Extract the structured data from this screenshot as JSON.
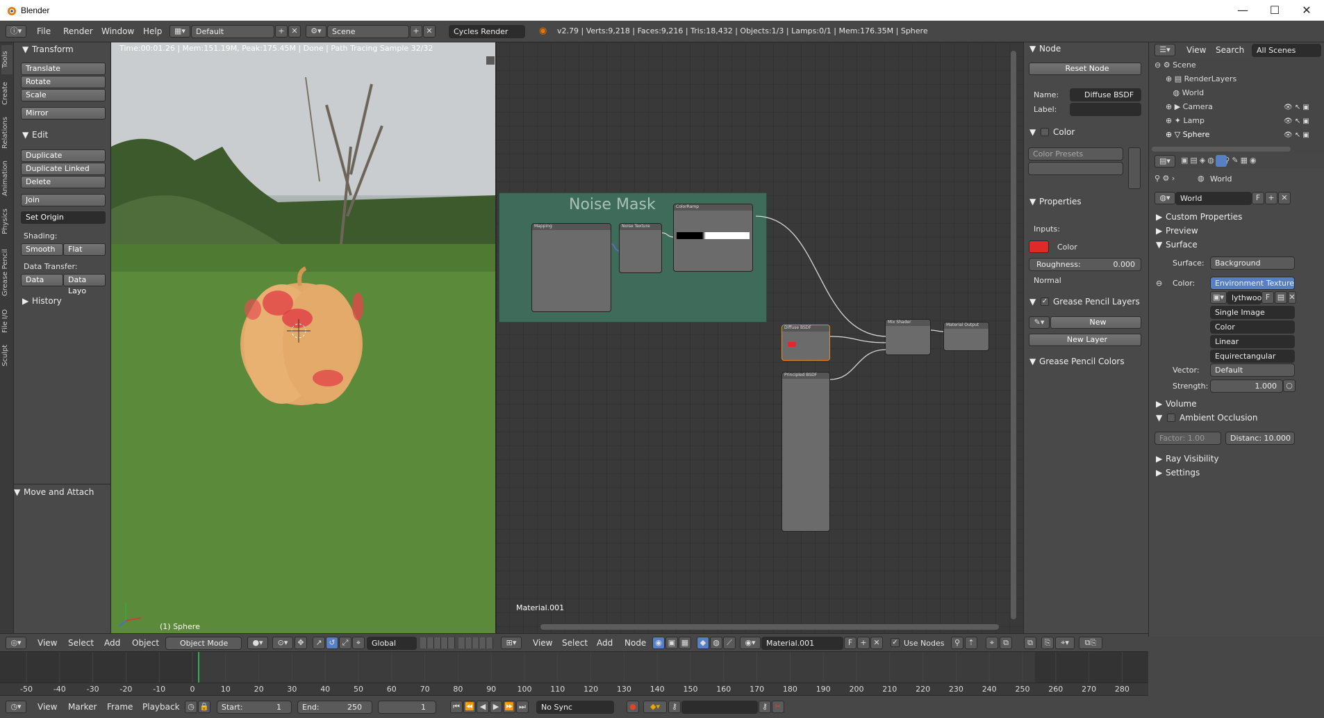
{
  "window": {
    "title": "Blender",
    "minimize": "—",
    "maximize": "☐",
    "close": "✕"
  },
  "infobar": {
    "menus": [
      "File",
      "Render",
      "Window",
      "Help"
    ],
    "screen_layout": "Default",
    "scene": "Scene",
    "engine": "Cycles Render",
    "stats": "v2.79 | Verts:9,218 | Faces:9,216 | Tris:18,432 | Objects:1/3 | Lamps:0/1 | Mem:176.35M | Sphere"
  },
  "tool_tabs": [
    "Tools",
    "Create",
    "Relations",
    "Animation",
    "Physics",
    "Grease Pencil",
    "File I/O",
    "Sculpt"
  ],
  "toolshelf": {
    "transform_header": "Transform",
    "translate": "Translate",
    "rotate": "Rotate",
    "scale": "Scale",
    "mirror": "Mirror",
    "edit_header": "Edit",
    "duplicate": "Duplicate",
    "duplicate_linked": "Duplicate Linked",
    "delete": "Delete",
    "join": "Join",
    "set_origin": "Set Origin",
    "shading_label": "Shading:",
    "smooth": "Smooth",
    "flat": "Flat",
    "data_transfer_label": "Data Transfer:",
    "data": "Data",
    "data_layout": "Data Layo",
    "history_header": "History",
    "move_attach": "Move and Attach"
  },
  "viewport": {
    "render_status": "Time:00:01.26 | Mem:151.19M, Peak:175.45M | Done | Path Tracing Sample 32/32",
    "object_label": "(1) Sphere"
  },
  "node_editor": {
    "frame_label": "Noise Mask",
    "material_label": "Material.001",
    "nodes": {
      "mapping": "Mapping",
      "noise_texture": "Noise Texture",
      "color_ramp": "ColorRamp",
      "diffuse": "Diffuse BSDF",
      "principled": "Principled BSDF",
      "mix_shader": "Mix Shader",
      "material_output": "Material Output"
    }
  },
  "node_panel": {
    "node_header": "Node",
    "reset_node": "Reset Node",
    "name_label": "Name:",
    "name_value": "Diffuse BSDF",
    "label_label": "Label:",
    "label_value": "",
    "color_header": "Color",
    "color_presets": "Color Presets",
    "properties_header": "Properties",
    "inputs_label": "Inputs:",
    "color_input": "Color",
    "roughness_label": "Roughness:",
    "roughness_value": "0.000",
    "normal_label": "Normal",
    "grease_layers_header": "Grease Pencil Layers",
    "new": "New",
    "new_layer": "New Layer",
    "grease_colors_header": "Grease Pencil Colors"
  },
  "outliner": {
    "view": "View",
    "search": "Search",
    "filter": "All Scenes",
    "items": [
      {
        "label": "Scene"
      },
      {
        "label": "RenderLayers"
      },
      {
        "label": "World"
      },
      {
        "label": "Camera"
      },
      {
        "label": "Lamp"
      },
      {
        "label": "Sphere"
      }
    ]
  },
  "properties": {
    "context": "World",
    "world_name": "World",
    "world_f": "F",
    "custom_properties": "Custom Properties",
    "preview": "Preview",
    "surface_header": "Surface",
    "surface_label": "Surface:",
    "surface_value": "Background",
    "color_label": "Color:",
    "color_value": "Environment Texture",
    "image_name": "lythwood",
    "image_f": "F",
    "source": "Single Image",
    "color_space": "Color",
    "interpolation": "Linear",
    "projection": "Equirectangular",
    "vector_label": "Vector:",
    "vector_value": "Default",
    "strength_label": "Strength:",
    "strength_value": "1.000",
    "volume": "Volume",
    "ao_header": "Ambient Occlusion",
    "factor_label": "Factor:",
    "factor_value": "1.00",
    "distance_label": "Distanc:",
    "distance_value": "10.000",
    "ray_visibility": "Ray Visibility",
    "settings": "Settings"
  },
  "view3d_header": {
    "menus": [
      "View",
      "Select",
      "Add",
      "Object"
    ],
    "mode": "Object Mode",
    "orientation": "Global"
  },
  "node_header": {
    "menus": [
      "View",
      "Select",
      "Add",
      "Node"
    ],
    "material": "Material.001",
    "f": "F",
    "use_nodes": "Use Nodes"
  },
  "timeline": {
    "ticks": [
      "-50",
      "-40",
      "-30",
      "-20",
      "-10",
      "0",
      "10",
      "20",
      "30",
      "40",
      "50",
      "60",
      "70",
      "80",
      "90",
      "100",
      "110",
      "120",
      "130",
      "140",
      "150",
      "160",
      "170",
      "180",
      "190",
      "200",
      "210",
      "220",
      "230",
      "240",
      "250",
      "260",
      "270",
      "280"
    ],
    "menus": [
      "View",
      "Marker",
      "Frame",
      "Playback"
    ],
    "start_label": "Start:",
    "start_value": "1",
    "end_label": "End:",
    "end_value": "250",
    "current_frame": "1",
    "sync": "No Sync"
  },
  "colors": {
    "accent_blue": "#5680c2",
    "red_swatch": "#e02a2a",
    "frame_green": "#3f6c5a",
    "cursor_green": "#2fb24a"
  }
}
